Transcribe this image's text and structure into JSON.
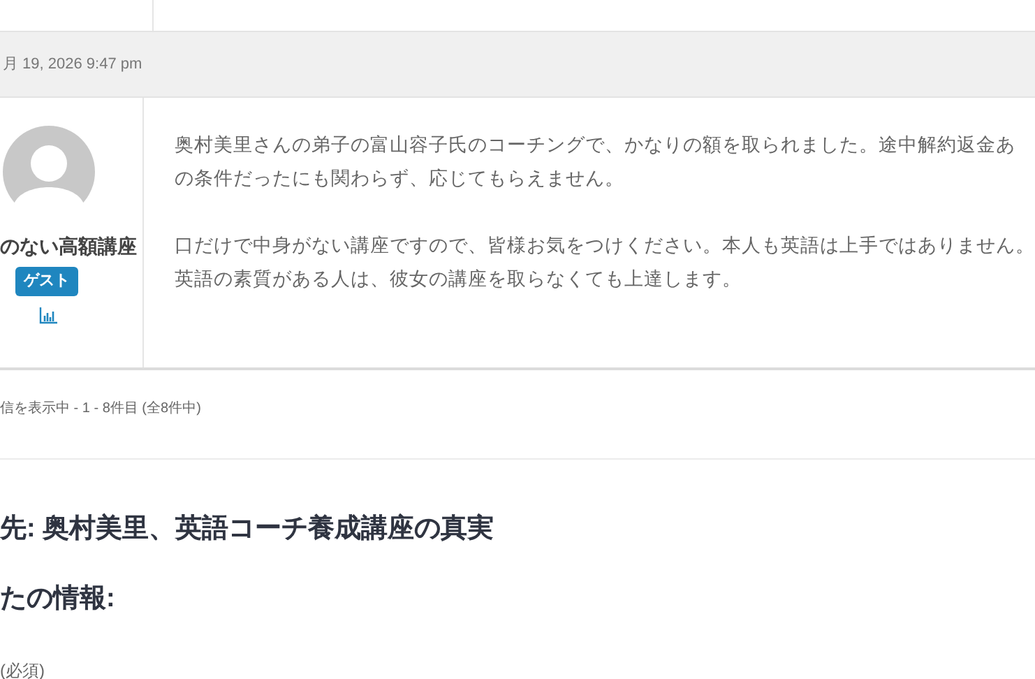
{
  "reply": {
    "date": "月 19, 2026 9:47 pm",
    "author": {
      "name": "のない高額講座",
      "role": "ゲスト"
    },
    "paragraphs": [
      [
        "奥村美里さんの弟子の富山容子氏のコーチングで、かなりの額を取られました。途中解約返金あ",
        "の条件だったにも関わらず、応じてもらえません。"
      ],
      [
        "口だけで中身がない講座ですので、皆様お気をつけください。本人も英語は上手ではありません。",
        "英語の素質がある人は、彼女の講座を取らなくても上達します。"
      ]
    ]
  },
  "pagination": "信を表示中 - 1 - 8件目 (全8件中)",
  "reply_form": {
    "title": "先: 奥村美里、英語コーチ養成講座の真実",
    "section": "たの情報:",
    "field_label": "(必須)"
  }
}
